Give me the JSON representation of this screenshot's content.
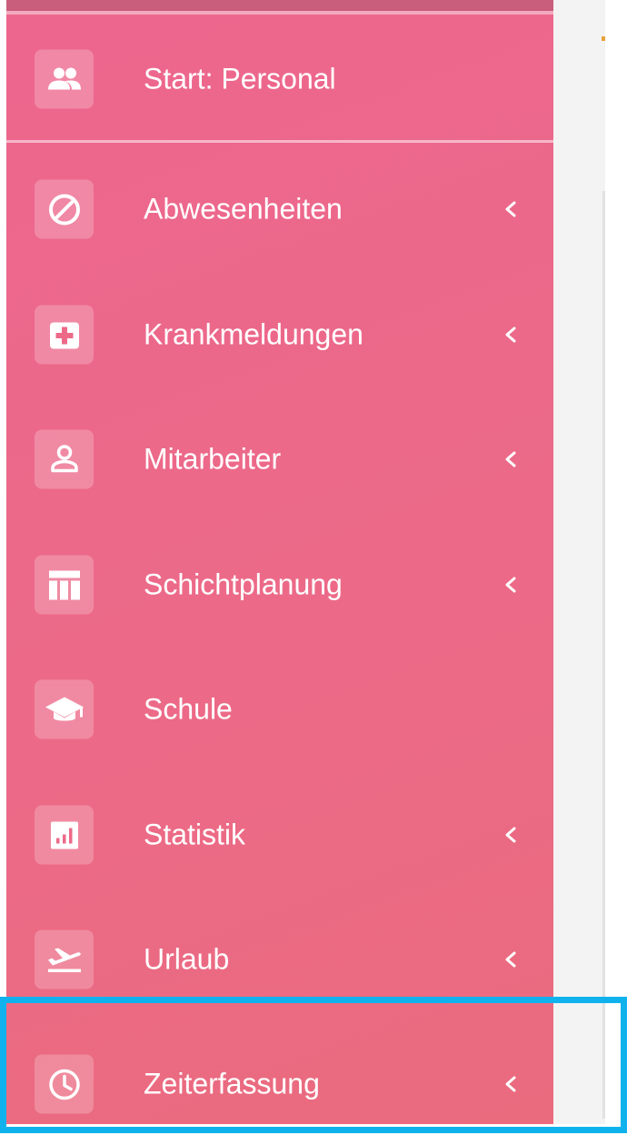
{
  "sidebar": {
    "items": [
      {
        "label": "Start: Personal",
        "icon": "people-icon"
      },
      {
        "label": "Abwesenheiten",
        "icon": "block-icon",
        "chevron": true
      },
      {
        "label": "Krankmeldungen",
        "icon": "medical-cross-icon",
        "chevron": true
      },
      {
        "label": "Mitarbeiter",
        "icon": "person-icon",
        "chevron": true
      },
      {
        "label": "Schichtplanung",
        "icon": "table-icon",
        "chevron": true
      },
      {
        "label": "Schule",
        "icon": "graduation-cap-icon"
      },
      {
        "label": "Statistik",
        "icon": "bar-chart-icon",
        "chevron": true
      },
      {
        "label": "Urlaub",
        "icon": "airplane-departure-icon",
        "chevron": true
      },
      {
        "label": "Zeiterfassung",
        "icon": "clock-icon",
        "chevron": true
      }
    ]
  },
  "colors": {
    "sidebar_background": "#ec6a88",
    "highlight_border": "#10b2ee",
    "text": "#ffffff"
  }
}
